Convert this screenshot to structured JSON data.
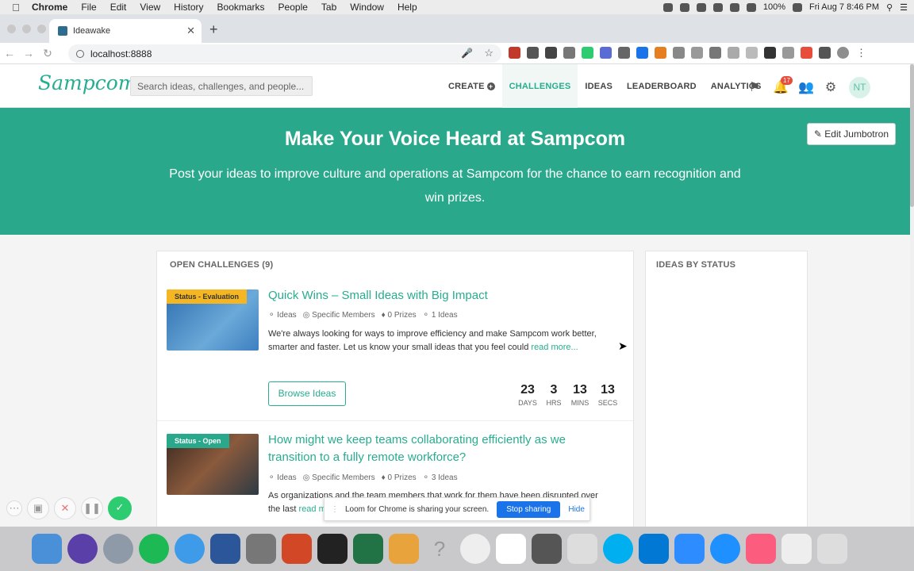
{
  "macbar": {
    "app": "Chrome",
    "menus": [
      "File",
      "Edit",
      "View",
      "History",
      "Bookmarks",
      "People",
      "Tab",
      "Window",
      "Help"
    ],
    "battery": "100%",
    "datetime": "Fri Aug 7  8:46 PM"
  },
  "browser": {
    "tab_title": "Ideawake",
    "url": "localhost:8888"
  },
  "app": {
    "logo": "Sampcom",
    "search_placeholder": "Search ideas, challenges, and people...",
    "nav": [
      "CREATE",
      "CHALLENGES",
      "IDEAS",
      "LEADERBOARD",
      "ANALYTICS"
    ],
    "notification_count": "17",
    "avatar_initials": "NT"
  },
  "jumbotron": {
    "title": "Make Your Voice Heard at Sampcom",
    "subtitle": "Post your ideas to improve culture and operations at Sampcom for the chance to earn recognition and win prizes.",
    "edit_label": "Edit Jumbotron"
  },
  "challenges": {
    "header": "OPEN CHALLENGES (9)",
    "items": [
      {
        "status": "Status - Evaluation",
        "title": "Quick Wins – Small Ideas with Big Impact",
        "meta": [
          "Ideas",
          "Specific Members",
          "0 Prizes",
          "1 Ideas"
        ],
        "description": "We're always looking for ways to improve efficiency and make Sampcom work better, smarter and faster. Let us know your small ideas that you feel could",
        "read_more": "read more...",
        "browse_label": "Browse Ideas",
        "countdown": [
          {
            "value": "23",
            "unit": "DAYS"
          },
          {
            "value": "3",
            "unit": "HRS"
          },
          {
            "value": "13",
            "unit": "MINS"
          },
          {
            "value": "13",
            "unit": "SECS"
          }
        ]
      },
      {
        "status": "Status - Open",
        "title": "How might we keep teams collaborating efficiently as we transition to a fully remote workforce?",
        "meta": [
          "Ideas",
          "Specific Members",
          "0 Prizes",
          "3 Ideas"
        ],
        "description": "As organizations and the team members that work for them have been disrupted over the last",
        "read_more": "read more..."
      }
    ]
  },
  "status_panel": {
    "header": "IDEAS BY STATUS"
  },
  "loom": {
    "message": "Loom for Chrome is sharing your screen.",
    "stop_label": "Stop sharing",
    "hide_label": "Hide"
  },
  "colors": {
    "brand": "#27ad8f",
    "jumbotron": "#2aa88b",
    "evaluation_badge": "#f5b623",
    "open_badge": "#2aa88b"
  }
}
